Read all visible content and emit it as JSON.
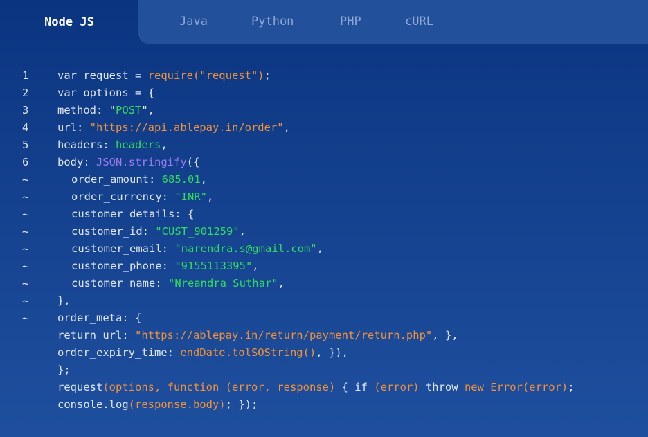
{
  "tabs": {
    "active": "Node JS",
    "others": [
      "Java",
      "Python",
      "PHP",
      "cURL"
    ]
  },
  "code": {
    "line_numbers": [
      "1",
      "2",
      "3",
      "4",
      "5",
      "6",
      "~",
      "~",
      "~",
      "~",
      "~",
      "~",
      "~",
      "~",
      "~",
      "",
      "",
      "",
      "",
      ""
    ],
    "lines": [
      [
        {
          "t": "var request = ",
          "c": "plain"
        },
        {
          "t": "require(\"request\")",
          "c": "or"
        },
        {
          "t": ";",
          "c": "plain"
        }
      ],
      [
        {
          "t": "var options = {",
          "c": "plain"
        }
      ],
      [
        {
          "t": "method: ",
          "c": "plain"
        },
        {
          "t": "\"",
          "c": "plain"
        },
        {
          "t": "POST",
          "c": "gr"
        },
        {
          "t": "\",",
          "c": "plain"
        }
      ],
      [
        {
          "t": "url: ",
          "c": "plain"
        },
        {
          "t": "\"https://api.ablepay.in/order\"",
          "c": "or"
        },
        {
          "t": ",",
          "c": "plain"
        }
      ],
      [
        {
          "t": "headers: ",
          "c": "plain"
        },
        {
          "t": "headers",
          "c": "gr"
        },
        {
          "t": ",",
          "c": "plain"
        }
      ],
      [
        {
          "t": "body: ",
          "c": "plain"
        },
        {
          "t": "JSON.stringify",
          "c": "pu"
        },
        {
          "t": "({",
          "c": "plain"
        }
      ],
      [
        {
          "t": "order_amount: ",
          "c": "plain"
        },
        {
          "t": "685.01",
          "c": "gr"
        },
        {
          "t": ",",
          "c": "plain"
        }
      ],
      [
        {
          "t": "order_currency: ",
          "c": "plain"
        },
        {
          "t": "\"INR\"",
          "c": "gr"
        },
        {
          "t": ",",
          "c": "plain"
        }
      ],
      [
        {
          "t": "customer_details: {",
          "c": "plain"
        }
      ],
      [
        {
          "t": "customer_id: ",
          "c": "plain"
        },
        {
          "t": "\"CUST_901259\"",
          "c": "gr"
        },
        {
          "t": ",",
          "c": "plain"
        }
      ],
      [
        {
          "t": "customer_email: ",
          "c": "plain"
        },
        {
          "t": "\"narendra.s@gmail.com\"",
          "c": "gr"
        },
        {
          "t": ",",
          "c": "plain"
        }
      ],
      [
        {
          "t": "customer_phone: ",
          "c": "plain"
        },
        {
          "t": "\"9155113395\"",
          "c": "gr"
        },
        {
          "t": ",",
          "c": "plain"
        }
      ],
      [
        {
          "t": "customer_name: ",
          "c": "plain"
        },
        {
          "t": "\"Nreandra Suthar\"",
          "c": "gr"
        },
        {
          "t": ",",
          "c": "plain"
        }
      ],
      [
        {
          "t": "},",
          "c": "plain"
        }
      ],
      [
        {
          "t": "order_meta: {",
          "c": "plain"
        }
      ],
      [
        {
          "t": "return_url: ",
          "c": "plain"
        },
        {
          "t": "\"https://ablepay.in/return/payment/return.php\"",
          "c": "or"
        },
        {
          "t": ", },",
          "c": "plain"
        }
      ],
      [
        {
          "t": "order_expiry_time: ",
          "c": "plain"
        },
        {
          "t": "endDate.tolSOString()",
          "c": "or"
        },
        {
          "t": ", }),",
          "c": "plain"
        }
      ],
      [
        {
          "t": "};",
          "c": "plain"
        }
      ],
      [
        {
          "t": "request",
          "c": "plain"
        },
        {
          "t": "(options, function (error, response)",
          "c": "or"
        },
        {
          "t": " { if ",
          "c": "plain"
        },
        {
          "t": "(error)",
          "c": "or"
        },
        {
          "t": " throw ",
          "c": "plain"
        },
        {
          "t": "new Error(error)",
          "c": "or"
        },
        {
          "t": ";",
          "c": "plain"
        }
      ],
      [
        {
          "t": "console.log",
          "c": "plain"
        },
        {
          "t": "(response.body)",
          "c": "or"
        },
        {
          "t": "; });",
          "c": "plain"
        }
      ]
    ]
  },
  "colors": {
    "background_top": "#0a3480",
    "background_bottom": "#1e4f9e",
    "tab_bar": "#22509a",
    "keyword_orange": "#f0923a",
    "string_green": "#2fdc5e",
    "function_purple": "#9d7bf2"
  }
}
